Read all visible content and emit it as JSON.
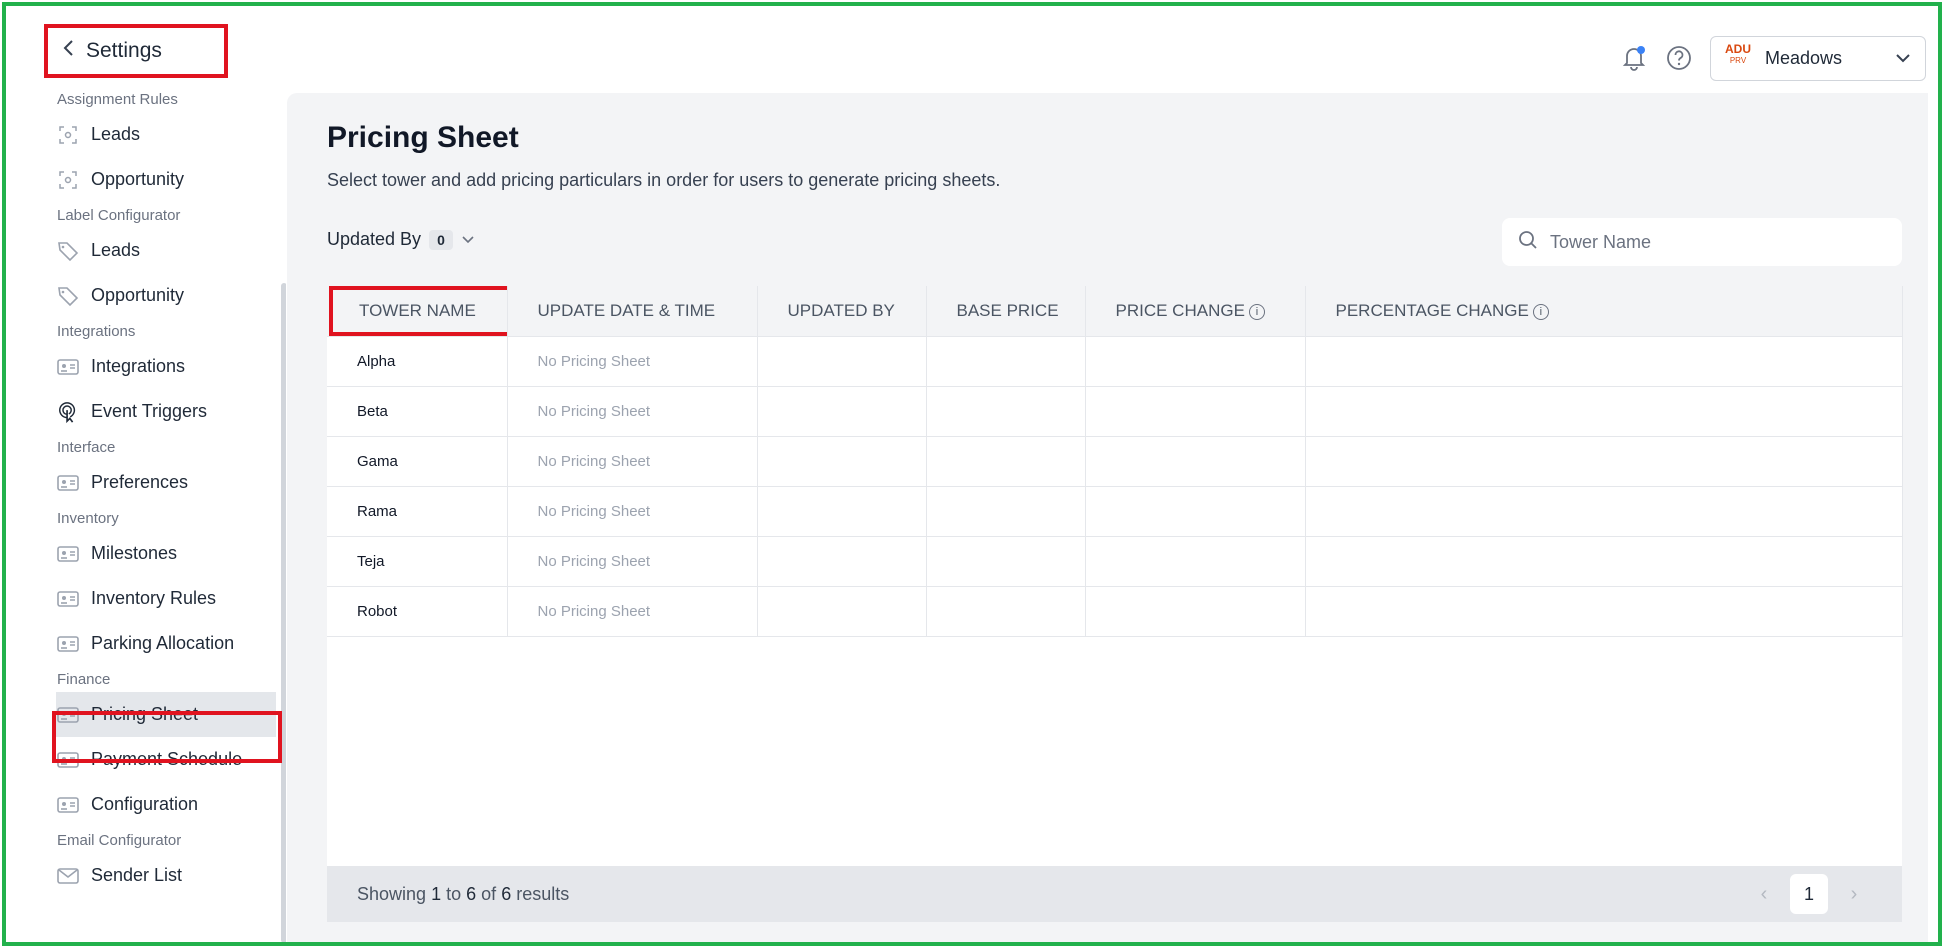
{
  "header": {
    "back_label": "Settings",
    "company_name": "Meadows",
    "company_logo_text": "ADU",
    "company_logo_sub": "PRV"
  },
  "sidebar": {
    "sections": [
      {
        "label": "Assignment Rules",
        "items": [
          {
            "label": "Leads",
            "icon": "target-icon"
          },
          {
            "label": "Opportunity",
            "icon": "target-icon"
          }
        ]
      },
      {
        "label": "Label Configurator",
        "items": [
          {
            "label": "Leads",
            "icon": "tag-icon"
          },
          {
            "label": "Opportunity",
            "icon": "tag-icon"
          }
        ]
      },
      {
        "label": "Integrations",
        "items": [
          {
            "label": "Integrations",
            "icon": "id-card-icon"
          },
          {
            "label": "Event Triggers",
            "icon": "tap-icon"
          }
        ]
      },
      {
        "label": "Interface",
        "items": [
          {
            "label": "Preferences",
            "icon": "id-card-icon"
          }
        ]
      },
      {
        "label": "Inventory",
        "items": [
          {
            "label": "Milestones",
            "icon": "id-card-icon"
          },
          {
            "label": "Inventory Rules",
            "icon": "id-card-icon"
          },
          {
            "label": "Parking Allocation",
            "icon": "id-card-icon"
          }
        ]
      },
      {
        "label": "Finance",
        "items": [
          {
            "label": "Pricing Sheet",
            "icon": "id-card-icon",
            "active": true
          },
          {
            "label": "Payment Schedule",
            "icon": "id-card-icon"
          },
          {
            "label": "Configuration",
            "icon": "id-card-icon"
          }
        ]
      },
      {
        "label": "Email Configurator",
        "items": [
          {
            "label": "Sender List",
            "icon": "mail-icon"
          }
        ]
      }
    ]
  },
  "main": {
    "title": "Pricing Sheet",
    "subtitle": "Select tower and add pricing particulars in order for users to generate pricing sheets.",
    "filter_label": "Updated By",
    "filter_count": "0",
    "search_placeholder": "Tower Name",
    "columns": [
      "TOWER NAME",
      "UPDATE DATE & TIME",
      "UPDATED BY",
      "BASE PRICE",
      "PRICE CHANGE",
      "PERCENTAGE CHANGE"
    ],
    "rows": [
      {
        "tower": "Alpha",
        "updated": "No Pricing Sheet"
      },
      {
        "tower": "Beta",
        "updated": "No Pricing Sheet"
      },
      {
        "tower": "Gama",
        "updated": "No Pricing Sheet"
      },
      {
        "tower": "Rama",
        "updated": "No Pricing Sheet"
      },
      {
        "tower": "Teja",
        "updated": "No Pricing Sheet"
      },
      {
        "tower": "Robot",
        "updated": "No Pricing Sheet"
      }
    ],
    "footer": {
      "prefix": "Showing",
      "from": "1",
      "to_word": "to",
      "to": "6",
      "of_word": "of",
      "total": "6",
      "suffix": "results",
      "current_page": "1"
    }
  }
}
